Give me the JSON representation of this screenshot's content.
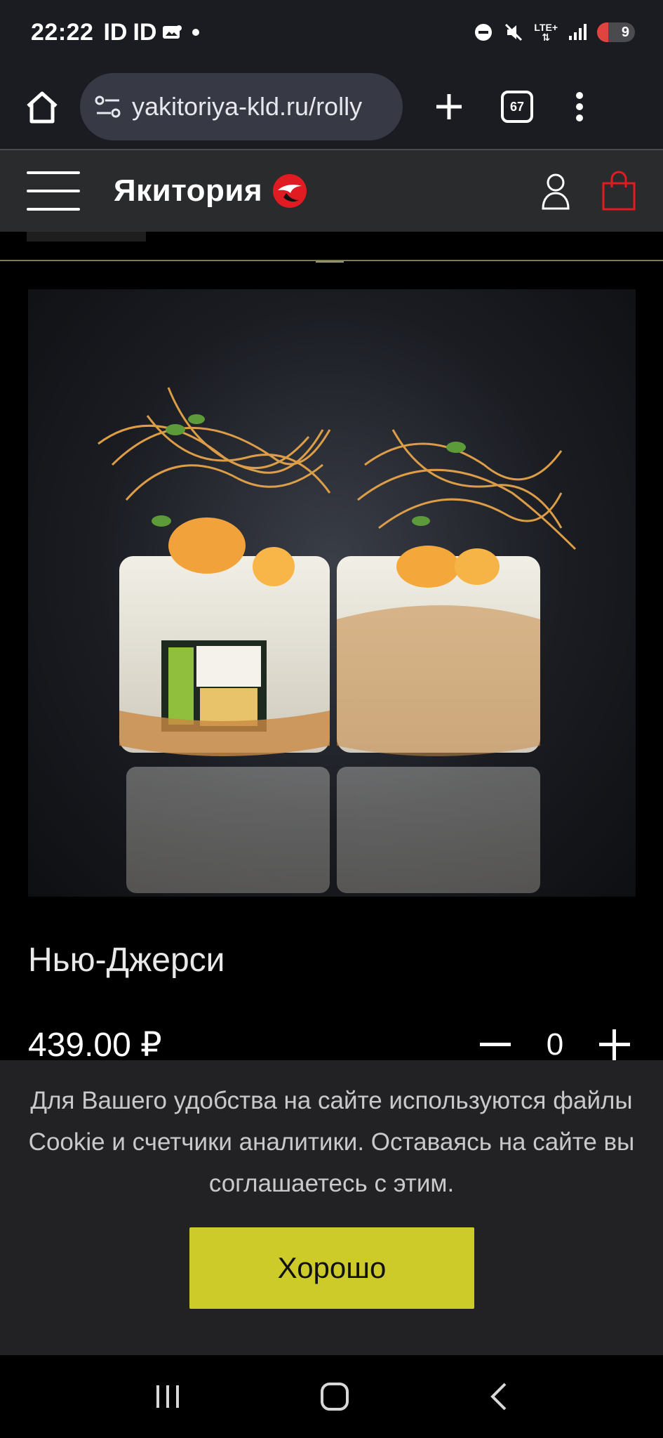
{
  "status_bar": {
    "time": "22:22",
    "left_indicators": [
      "ID",
      "ID"
    ],
    "network": "LTE+",
    "battery_level": "9"
  },
  "browser": {
    "url": "yakitoriya-kld.ru/rolly",
    "tab_count": "67",
    "icons": [
      "home-icon",
      "site-settings-icon",
      "new-tab-icon",
      "tabs-icon",
      "menu-icon"
    ]
  },
  "site_header": {
    "logo_text": "Якитория",
    "icons": [
      "hamburger-icon",
      "user-icon",
      "cart-icon"
    ],
    "accent_color": "#e11b22"
  },
  "product": {
    "name": "Нью-Джерси",
    "price": "439.00 ₽",
    "quantity": "0"
  },
  "cookie_banner": {
    "text": "Для Вашего удобства на сайте используются файлы Cookie и счетчики аналитики. Оставаясь на сайте вы соглашаетесь с этим.",
    "button_label": "Хорошо",
    "button_color": "#cccb2a"
  }
}
